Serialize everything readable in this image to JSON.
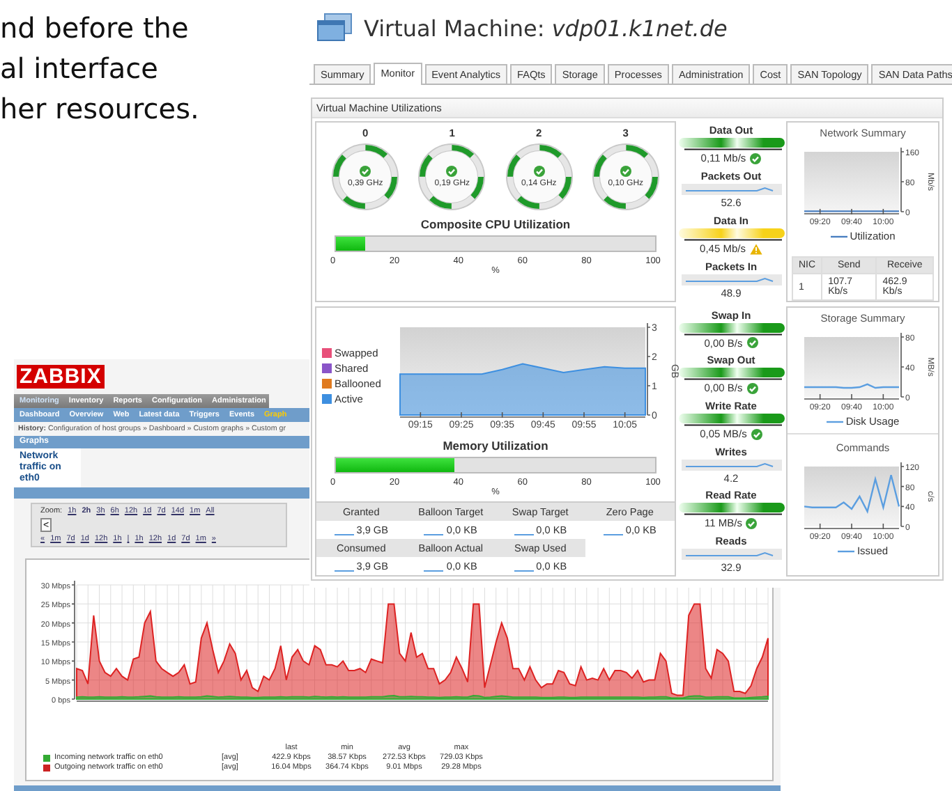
{
  "document_text": [
    "nd before the",
    "al interface",
    "her resources."
  ],
  "vm_window": {
    "title": "Virtual Machine: *vdp01.k1net.de*",
    "tabs": [
      {
        "label": "Summary",
        "selected": false
      },
      {
        "label": "Monitor",
        "selected": true
      },
      {
        "label": "Event Analytics",
        "selected": false
      },
      {
        "label": "FAQts",
        "selected": false
      },
      {
        "label": "Storage",
        "selected": false
      },
      {
        "label": "Processes",
        "selected": false
      },
      {
        "label": "Administration",
        "selected": false
      },
      {
        "label": "Cost",
        "selected": false
      },
      {
        "label": "SAN Topology",
        "selected": false
      },
      {
        "label": "SAN Data Paths",
        "selected": false
      }
    ],
    "panel_title": "Virtual Machine Utilizations",
    "cpus": [
      {
        "label": "0",
        "value": "0,39 GHz",
        "warning": false
      },
      {
        "label": "1",
        "value": "0,19 GHz",
        "warning": false
      },
      {
        "label": "2",
        "value": "0,14 GHz",
        "warning": false
      },
      {
        "label": "3",
        "value": "0,10 GHz",
        "warning": false
      }
    ],
    "cpu_meter": {
      "title": "Composite CPU Utilization",
      "level": 0.09,
      "ticks": [
        "0",
        "20",
        "40",
        "60",
        "80",
        "100"
      ],
      "unit": "%"
    },
    "memory_legend": [
      {
        "label": "Swapped",
        "color": "#e8507a"
      },
      {
        "label": "Shared",
        "color": "#8a55c8"
      },
      {
        "label": "Ballooned",
        "color": "#e07b20"
      },
      {
        "label": "Active",
        "color": "#3d8fe0"
      }
    ],
    "memory_chart": {
      "chart_data": {
        "type": "area",
        "ylabel": "GB",
        "categories": [
          null,
          "09:15",
          null,
          "09:25",
          null,
          "09:35",
          null,
          "09:45",
          null,
          "09:55",
          null,
          "10:05",
          null
        ],
        "ylim": [
          0,
          3
        ],
        "series": [
          {
            "color": "#3d8fe0",
            "values": [
              1.4,
              1.4,
              1.4,
              1.4,
              1.4,
              1.55,
              1.75,
              1.6,
              1.45,
              1.55,
              1.65,
              1.6,
              1.6
            ]
          }
        ],
        "yticks": [
          {
            "value": 0,
            "label": "0"
          },
          {
            "value": 1,
            "label": "1"
          },
          {
            "value": 2,
            "label": "2"
          },
          {
            "value": 3,
            "label": "3"
          }
        ]
      }
    },
    "memory_meter": {
      "title": "Memory Utilization",
      "level": 0.37,
      "ticks": [
        "0",
        "20",
        "40",
        "60",
        "80",
        "100"
      ],
      "unit": "%"
    },
    "memory_table": [
      {
        "label": "Granted",
        "value": "3,9 GB"
      },
      {
        "label": "Balloon Target",
        "value": "0,0 KB"
      },
      {
        "label": "Swap Target",
        "value": "0,0 KB"
      },
      {
        "label": "Zero Page",
        "value": "0,0 KB"
      },
      {
        "label": "Consumed",
        "value": "3,9 GB"
      },
      {
        "label": "Balloon Actual",
        "value": "0,0 KB"
      },
      {
        "label": "Swap Used",
        "value": "0,0 KB"
      }
    ],
    "network_metrics": [
      {
        "kind": "gauge",
        "title": "Data Out",
        "value": "0,11 Mb/s",
        "warning": false
      },
      {
        "kind": "sparkline",
        "title": "Packets Out",
        "value": "52.6"
      },
      {
        "kind": "gauge",
        "title": "Data In",
        "value": "0,45 Mb/s",
        "warning": true
      },
      {
        "kind": "sparkline",
        "title": "Packets In",
        "value": "48.9"
      }
    ],
    "disk_metrics": [
      {
        "kind": "gauge",
        "title": "Swap In",
        "value": "0,00 B/s",
        "warning": false
      },
      {
        "kind": "gauge",
        "title": "Swap Out",
        "value": "0,00 B/s",
        "warning": false
      },
      {
        "kind": "gauge",
        "title": "Write Rate",
        "value": "0,05 MB/s",
        "warning": false
      },
      {
        "kind": "sparkline",
        "title": "Writes",
        "value": "4.2"
      },
      {
        "kind": "gauge",
        "title": "Read Rate",
        "value": "11 MB/s",
        "warning": false
      },
      {
        "kind": "sparkline",
        "title": "Reads",
        "value": "32.9"
      }
    ],
    "network_summary": {
      "chart_data": {
        "type": "line",
        "title": "Network Summary",
        "ylabel": "Mb/s",
        "categories": [
          null,
          null,
          "09:20",
          null,
          null,
          null,
          "09:40",
          null,
          null,
          null,
          "10:00",
          null,
          null
        ],
        "ylim": [
          0,
          160
        ],
        "series": [
          {
            "name": "Utilization",
            "color": "#4a7fc0",
            "values": [
              1,
              1,
              1,
              1,
              1,
              1,
              1,
              1,
              1,
              1,
              1,
              1,
              1
            ]
          }
        ],
        "yticks": [
          {
            "value": 0,
            "label": "0"
          },
          {
            "value": 80,
            "label": "80"
          },
          {
            "value": 160,
            "label": "160"
          }
        ]
      }
    },
    "nic_table": {
      "columns": [
        "NIC",
        "Send",
        "Receive"
      ],
      "rows": [
        [
          "1",
          "107.7 Kb/s",
          "462.9 Kb/s"
        ]
      ]
    },
    "storage_summary": {
      "chart_data": {
        "type": "line",
        "title": "Storage Summary",
        "ylabel": "MB/s",
        "categories": [
          null,
          null,
          "09:20",
          null,
          null,
          null,
          "09:40",
          null,
          null,
          null,
          "10:00",
          null,
          null
        ],
        "ylim": [
          0,
          80
        ],
        "series": [
          {
            "name": "Disk Usage",
            "color": "#5b9ee0",
            "values": [
              13,
              13,
              13,
              13,
              13,
              12,
              12,
              13,
              17,
              12,
              13,
              13,
              13
            ]
          }
        ],
        "yticks": [
          {
            "value": 0,
            "label": "0"
          },
          {
            "value": 40,
            "label": "40"
          },
          {
            "value": 80,
            "label": "80"
          }
        ]
      }
    },
    "commands": {
      "chart_data": {
        "type": "line",
        "title": "Commands",
        "ylabel": "c/s",
        "categories": [
          null,
          null,
          "09:20",
          null,
          null,
          null,
          "09:40",
          null,
          null,
          null,
          "10:00",
          null,
          null
        ],
        "ylim": [
          0,
          120
        ],
        "series": [
          {
            "name": "Issued",
            "color": "#5b9ee0",
            "values": [
              40,
              38,
              38,
              38,
              38,
              48,
              35,
              60,
              30,
              95,
              38,
              103,
              40
            ]
          }
        ],
        "yticks": [
          {
            "value": 0,
            "label": "0"
          },
          {
            "value": 40,
            "label": "40"
          },
          {
            "value": 80,
            "label": "80"
          },
          {
            "value": 120,
            "label": "120"
          }
        ]
      }
    }
  },
  "zabbix_window": {
    "logo": "ZABBIX",
    "main_menu": [
      {
        "label": "Monitoring",
        "selected": true
      },
      {
        "label": "Inventory",
        "selected": false
      },
      {
        "label": "Reports",
        "selected": false
      },
      {
        "label": "Configuration",
        "selected": false
      },
      {
        "label": "Administration",
        "selected": false
      }
    ],
    "sub_menu": [
      {
        "label": "Dashboard",
        "selected": false
      },
      {
        "label": "Overview",
        "selected": false
      },
      {
        "label": "Web",
        "selected": false
      },
      {
        "label": "Latest data",
        "selected": false
      },
      {
        "label": "Triggers",
        "selected": false
      },
      {
        "label": "Events",
        "selected": false
      },
      {
        "label": "Graph",
        "selected": true
      }
    ],
    "history": "**History:** Configuration of host groups » Dashboard » Custom graphs » Custom gr",
    "section_title": "Graphs",
    "graph_name": "Network traffic on eth0",
    "zoom_label": "Zoom:",
    "zoom_links": [
      {
        "label": "1h",
        "selected": false
      },
      {
        "label": "2h",
        "selected": true
      },
      {
        "label": "3h",
        "selected": false
      },
      {
        "label": "6h",
        "selected": false
      },
      {
        "label": "12h",
        "selected": false
      },
      {
        "label": "1d",
        "selected": false
      },
      {
        "label": "7d",
        "selected": false
      },
      {
        "label": "14d",
        "selected": false
      },
      {
        "label": "1m",
        "selected": false
      },
      {
        "label": "All",
        "selected": false
      }
    ],
    "nav_button": "<",
    "nav_links": [
      "«",
      "1m",
      "7d",
      "1d",
      "12h",
      "1h",
      "|",
      "1h",
      "12h",
      "1d",
      "7d",
      "1m",
      "»"
    ],
    "chart": {
      "chart_data": {
        "type": "area",
        "grid": true,
        "ylim": [
          0,
          30
        ],
        "yticks": [
          {
            "value": 0,
            "label": "0 bps"
          },
          {
            "value": 5,
            "label": "5 Mbps"
          },
          {
            "value": 10,
            "label": "10 Mbps"
          },
          {
            "value": 15,
            "label": "15 Mbps"
          },
          {
            "value": 20,
            "label": "20 Mbps"
          },
          {
            "value": 25,
            "label": "25 Mbps"
          },
          {
            "value": 30,
            "label": "30 Mbps"
          }
        ],
        "series": [
          {
            "color": "#dd2222",
            "values": [
              8,
              7.5,
              4,
              22,
              10,
              7,
              6,
              8,
              6,
              5,
              10.5,
              11,
              20,
              23,
              10,
              8,
              7,
              6,
              7,
              9,
              4,
              4.5,
              16,
              20,
              13,
              7,
              10,
              14.5,
              12,
              5,
              7.5,
              3,
              2,
              6,
              5,
              8,
              14,
              5,
              11,
              13,
              10,
              9,
              14,
              13,
              9,
              9,
              8.5,
              10,
              7.5,
              7.5,
              8,
              7,
              10.5,
              10,
              9.5,
              25,
              25,
              12,
              10,
              17.5,
              11,
              12,
              8,
              8,
              4,
              5,
              7,
              11,
              8,
              4.5,
              25,
              25,
              3,
              9,
              15,
              20,
              16,
              8,
              8,
              5,
              8.5,
              5,
              3,
              4,
              4,
              7.5,
              7,
              4,
              3.5,
              8.5,
              5,
              5.5,
              5,
              8,
              5,
              7.5,
              7.5,
              7,
              5.5,
              7.5,
              4.5,
              5,
              5,
              12,
              10,
              1.5,
              1,
              1,
              22,
              25,
              25,
              8,
              5.5,
              13,
              12,
              10,
              2,
              2,
              1.5,
              3.5,
              8,
              11,
              16
            ]
          },
          {
            "color": "#33aa33",
            "values": [
              0.5,
              0.6,
              0.5,
              0.5,
              0.6,
              0.5,
              0.5,
              0.5,
              0.6,
              0.5,
              0.5,
              0.6,
              0.7,
              0.8,
              0.6,
              0.5,
              0.5,
              0.5,
              0.6,
              0.5,
              0.5,
              0.5,
              0.6,
              0.8,
              0.7,
              0.5,
              0.6,
              0.7,
              0.6,
              0.5,
              0.5,
              0.4,
              0.4,
              0.5,
              0.5,
              0.5,
              0.6,
              0.5,
              0.6,
              0.6,
              0.6,
              0.5,
              0.7,
              0.6,
              0.5,
              0.6,
              0.5,
              0.6,
              0.5,
              0.5,
              0.5,
              0.5,
              0.6,
              0.6,
              0.6,
              0.8,
              0.9,
              0.6,
              0.6,
              0.7,
              0.6,
              0.6,
              0.5,
              0.5,
              0.4,
              0.5,
              0.5,
              0.6,
              0.5,
              0.5,
              0.9,
              0.8,
              0.4,
              0.5,
              0.7,
              0.8,
              0.7,
              0.5,
              0.5,
              0.5,
              0.5,
              0.5,
              0.4,
              0.4,
              0.4,
              0.5,
              0.5,
              0.4,
              0.4,
              0.5,
              0.5,
              0.5,
              0.5,
              0.5,
              0.5,
              0.5,
              0.5,
              0.5,
              0.5,
              0.5,
              0.4,
              0.5,
              0.5,
              0.6,
              0.6,
              0.3,
              0.3,
              0.3,
              0.7,
              0.8,
              0.8,
              0.5,
              0.5,
              0.6,
              0.6,
              0.6,
              0.3,
              0.3,
              0.3,
              0.4,
              0.5,
              0.6,
              0.7
            ]
          }
        ]
      }
    },
    "legend": {
      "columns": [
        "last",
        "min",
        "avg",
        "max"
      ],
      "rows": [
        {
          "color": "#33aa33",
          "name": "Incoming network traffic on eth0",
          "function": "[avg]",
          "values": [
            "422.9 Kbps",
            "38.57 Kbps",
            "272.53 Kbps",
            "729.03 Kbps"
          ]
        },
        {
          "color": "#cc2222",
          "name": "Outgoing network traffic on eth0",
          "function": "[avg]",
          "values": [
            "16.04 Mbps",
            "364.74 Kbps",
            "9.01 Mbps",
            "29.28 Mbps"
          ]
        }
      ]
    }
  }
}
